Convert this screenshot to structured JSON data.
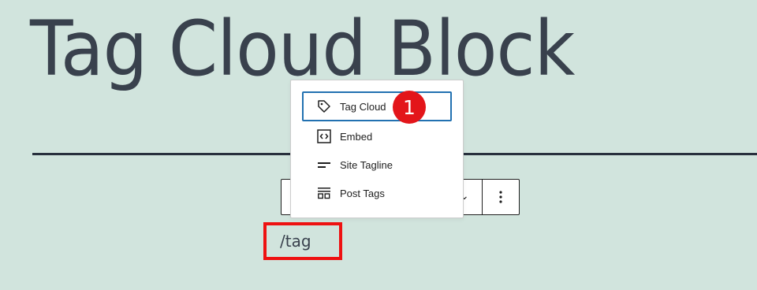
{
  "page": {
    "title": "Tag Cloud Block"
  },
  "block_toolbar": {
    "chevron": "⌄",
    "options_button_label": "⋮"
  },
  "autocomplete": {
    "items": [
      {
        "label": "Tag Cloud",
        "icon": "tag-icon",
        "selected": true
      },
      {
        "label": "Embed",
        "icon": "embed-icon",
        "selected": false
      },
      {
        "label": "Site Tagline",
        "icon": "site-tagline-icon",
        "selected": false
      },
      {
        "label": "Post Tags",
        "icon": "post-tags-icon",
        "selected": false
      }
    ]
  },
  "annotation": {
    "step_number": "1",
    "badge_color": "#e3151a",
    "highlight_color": "#ee1111"
  },
  "editor": {
    "slash_command": "/tag"
  },
  "colors": {
    "background": "#d1e4dd",
    "text": "#28303d",
    "focus": "#2271b1"
  }
}
